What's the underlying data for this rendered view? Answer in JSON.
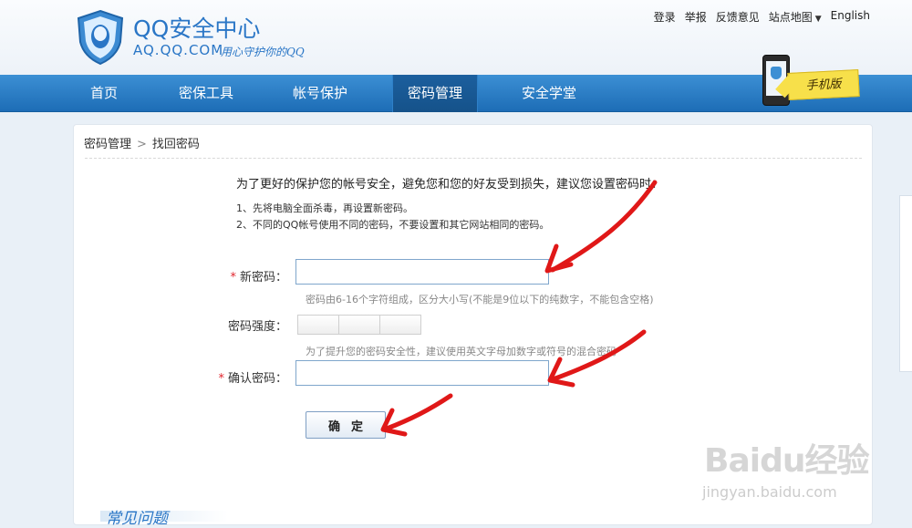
{
  "header": {
    "logo_title": "QQ安全中心",
    "logo_domain": "AQ.QQ.COM",
    "logo_slogan": "用心守护你的QQ",
    "links": {
      "login": "登录",
      "report": "举报",
      "feedback": "反馈意见",
      "sitemap": "站点地图",
      "english": "English"
    }
  },
  "nav": {
    "items": [
      {
        "label": "首页"
      },
      {
        "label": "密保工具"
      },
      {
        "label": "帐号保护"
      },
      {
        "label": "密码管理"
      },
      {
        "label": "安全学堂"
      }
    ],
    "active_index": 3,
    "mobile_label": "手机版"
  },
  "breadcrumb": {
    "parent": "密码管理",
    "separator": ">",
    "current": "找回密码"
  },
  "intro": "为了更好的保护您的帐号安全，避免您和您的好友受到损失，建议您设置密码时：",
  "tips": [
    "1、先将电脑全面杀毒，再设置新密码。",
    "2、不同的QQ帐号使用不同的密码，不要设置和其它网站相同的密码。"
  ],
  "form": {
    "required_mark": "*",
    "new_password_label": "新密码：",
    "new_password_value": "",
    "new_password_hint": "密码由6-16个字符组成，区分大小写(不能是9位以下的纯数字，不能包含空格)",
    "strength_label": "密码强度：",
    "strength_segments": 3,
    "strength_hint": "为了提升您的密码安全性，建议使用英文字母加数字或符号的混合密码",
    "confirm_label": "确认密码：",
    "confirm_value": "",
    "submit_label": "确定"
  },
  "faq_title": "常见问题",
  "watermark": {
    "logo_text": "Baidu经验",
    "url": "jingyan.baidu.com"
  },
  "colors": {
    "brand_blue": "#2a76c6",
    "nav_blue": "#1d6db6",
    "required_red": "#e1252d",
    "annotation_red": "#e01818"
  }
}
